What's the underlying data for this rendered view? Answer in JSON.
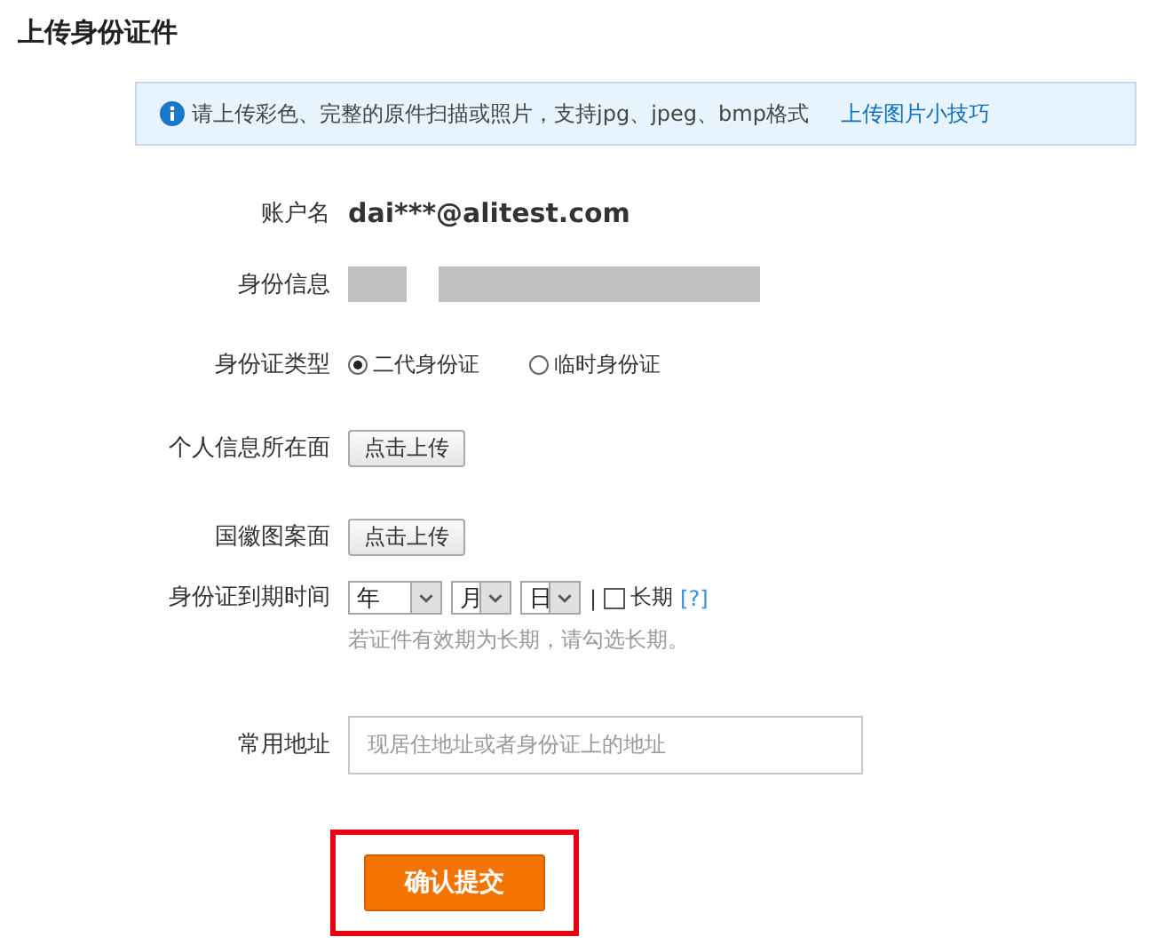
{
  "title": "上传身份证件",
  "notice": {
    "text": "请上传彩色、完整的原件扫描或照片，支持jpg、jpeg、bmp格式",
    "link": "上传图片小技巧"
  },
  "fields": [
    {
      "kind": "text",
      "label": "账户名",
      "value": "dai***@alitest.com"
    },
    {
      "kind": "redacted",
      "label": "身份信息"
    },
    {
      "kind": "radio",
      "label": "身份证类型",
      "options": [
        {
          "label": "二代身份证",
          "selected": true
        },
        {
          "label": "临时身份证",
          "selected": false
        }
      ]
    },
    {
      "kind": "upload",
      "label": "个人信息所在面",
      "button": "点击上传"
    },
    {
      "kind": "upload",
      "label": "国徽图案面",
      "button": "点击上传"
    },
    {
      "kind": "date",
      "label": "身份证到期时间",
      "selects": [
        "年",
        "月",
        "日"
      ],
      "separator": "|",
      "checkbox": {
        "label": "长期",
        "checked": false
      },
      "help": "[?]",
      "hint": "若证件有效期为长期，请勾选长期。"
    },
    {
      "kind": "address",
      "label": "常用地址",
      "placeholder": "现居住地址或者身份证上的地址"
    }
  ],
  "submit": {
    "label": "确认提交",
    "highlighted": true
  }
}
